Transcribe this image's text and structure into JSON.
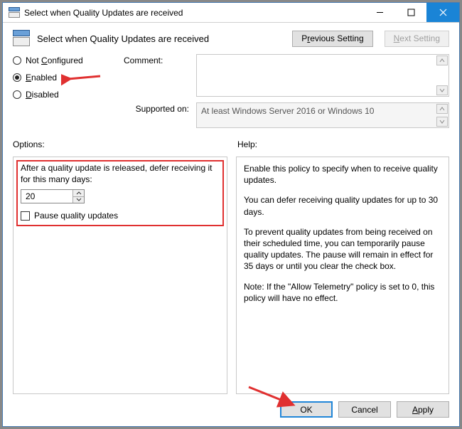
{
  "window": {
    "title": "Select when Quality Updates are received"
  },
  "header": {
    "title": "Select when Quality Updates are received",
    "prev_label_pre": "P",
    "prev_label_u": "r",
    "prev_label_post": "evious Setting",
    "next_label_pre": "",
    "next_label_u": "N",
    "next_label_post": "ext Setting"
  },
  "config": {
    "not_configured_pre": "Not ",
    "not_configured_u": "C",
    "not_configured_post": "onfigured",
    "enabled_u": "E",
    "enabled_post": "nabled",
    "disabled_u": "D",
    "disabled_post": "isabled",
    "selected": "enabled"
  },
  "fields": {
    "comment_label_u": "C",
    "comment_label_post": "omment:",
    "comment_value": "",
    "supported_label": "Supported on:",
    "supported_value": "At least Windows Server 2016 or Windows 10"
  },
  "sections": {
    "options_label": "Options:",
    "help_label": "Help:"
  },
  "options": {
    "defer_label": "After a quality update is released, defer receiving it for this many days:",
    "defer_days": "20",
    "pause_label": "Pause quality updates",
    "pause_checked": false
  },
  "help": {
    "p1": "Enable this policy to specify when to receive quality updates.",
    "p2": "You can defer receiving quality updates for up to 30 days.",
    "p3": "To prevent quality updates from being received on their scheduled time, you can temporarily pause quality updates. The pause will remain in effect for 35 days or until you clear the check box.",
    "p4": "Note: If the \"Allow Telemetry\" policy is set to 0, this policy will have no effect."
  },
  "footer": {
    "ok": "OK",
    "cancel": "Cancel",
    "apply_u": "A",
    "apply_post": "pply"
  }
}
